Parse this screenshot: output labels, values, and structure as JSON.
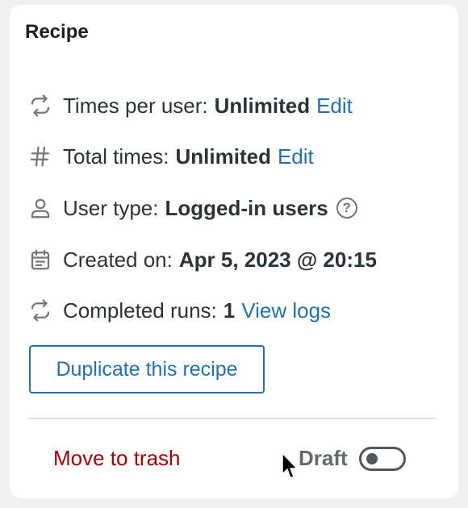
{
  "card": {
    "title": "Recipe"
  },
  "rows": {
    "times_per_user": {
      "icon": "repeat-icon",
      "label": "Times per user:",
      "value": "Unlimited",
      "link": "Edit"
    },
    "total_times": {
      "icon": "hash-icon",
      "label": "Total times:",
      "value": "Unlimited",
      "link": "Edit"
    },
    "user_type": {
      "icon": "user-icon",
      "label": "User type:",
      "value": "Logged-in users",
      "help": "?"
    },
    "created_on": {
      "icon": "calendar-icon",
      "label": "Created on:",
      "value": "Apr 5, 2023 @ 20:15"
    },
    "completed_runs": {
      "icon": "repeat-icon",
      "label": "Completed runs:",
      "value": "1",
      "link": "View logs"
    }
  },
  "actions": {
    "duplicate_label": "Duplicate this recipe",
    "trash_label": "Move to trash",
    "status_label": "Draft",
    "status_enabled": false
  },
  "colors": {
    "link": "#2271b1",
    "danger": "#aa0000",
    "text": "#2c3338",
    "muted": "#757575"
  }
}
